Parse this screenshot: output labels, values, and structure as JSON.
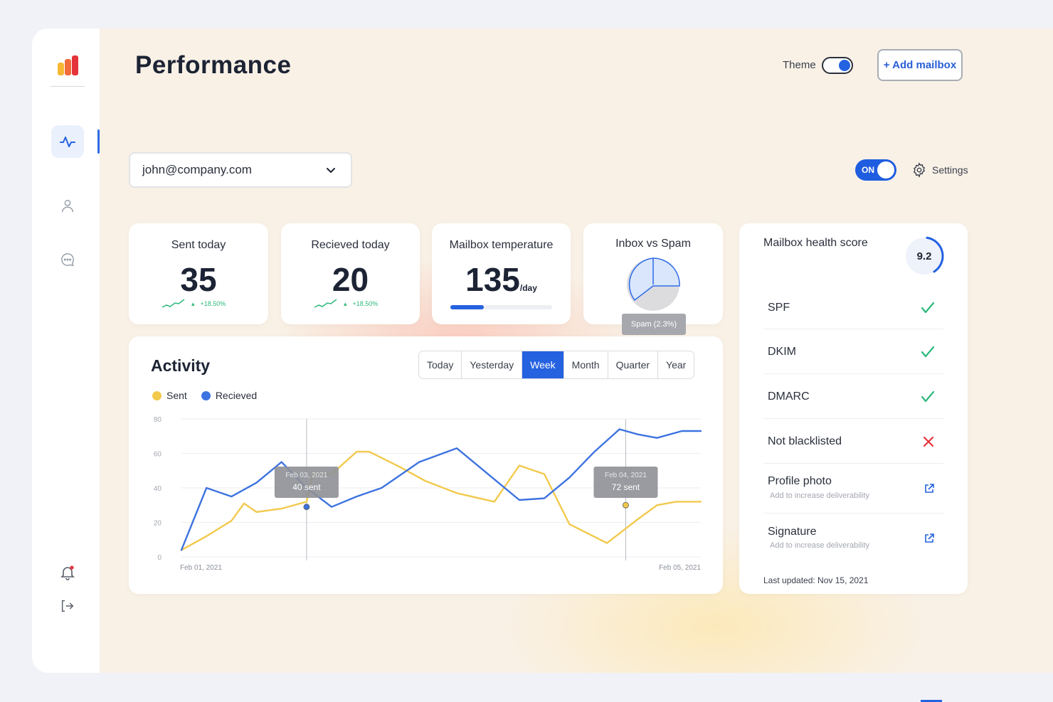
{
  "page": {
    "title": "Performance"
  },
  "header": {
    "theme_label": "Theme",
    "add_mailbox_label": "+ Add mailbox"
  },
  "mailbox": {
    "selected": "john@company.com"
  },
  "toggle": {
    "on_label": "ON"
  },
  "settings": {
    "label": "Settings"
  },
  "stats": [
    {
      "label": "Sent today",
      "value": "35",
      "trend": "+18.50%"
    },
    {
      "label": "Recieved today",
      "value": "20",
      "trend": "+18.50%"
    },
    {
      "label": "Mailbox temperature",
      "value": "135",
      "unit": "/day",
      "progress": 0.33
    }
  ],
  "inbox_spam": {
    "label": "Inbox vs Spam",
    "tooltip": "Spam (2.3%)",
    "spam_percent": 2.3
  },
  "activity": {
    "title": "Activity",
    "tabs": [
      "Today",
      "Yesterday",
      "Week",
      "Month",
      "Quarter",
      "Year"
    ],
    "active_tab": "Week",
    "legend": {
      "sent": "Sent",
      "received": "Recieved"
    }
  },
  "chart_data": {
    "type": "line",
    "x_range": [
      "Feb 01, 2021",
      "Feb 05, 2021"
    ],
    "xlabels": [
      "Feb 01, 2021",
      "Feb 05, 2021"
    ],
    "yticks": [
      "80",
      "60",
      "40",
      "20",
      "0"
    ],
    "ylim": [
      0,
      80
    ],
    "grid": true,
    "legend_position": "top-left",
    "series": [
      {
        "name": "Sent",
        "color": "#f2c94c",
        "x": [
          0,
          0.2,
          0.4,
          0.5,
          0.6,
          0.8,
          1.0,
          1.05,
          1.2,
          1.4,
          1.5,
          1.75,
          1.95,
          2.2,
          2.5,
          2.7,
          2.9,
          3.1,
          3.4,
          3.65,
          3.8,
          3.95,
          4.15
        ],
        "y": [
          4,
          12,
          21,
          31,
          26,
          28,
          32,
          48,
          48,
          61,
          61,
          52,
          44,
          37,
          32,
          53,
          48,
          19,
          8,
          22,
          30,
          32,
          32
        ]
      },
      {
        "name": "Recieved",
        "color": "#3d73e0",
        "x": [
          0,
          0.2,
          0.4,
          0.6,
          0.8,
          1.0,
          1.2,
          1.4,
          1.6,
          1.9,
          2.2,
          2.4,
          2.7,
          2.9,
          3.1,
          3.3,
          3.5,
          3.65,
          3.8,
          4.0,
          4.15
        ],
        "y": [
          4,
          40,
          35,
          43,
          55,
          40,
          29,
          35,
          40,
          55,
          63,
          51,
          33,
          34,
          46,
          61,
          74,
          71,
          69,
          73,
          73
        ]
      }
    ],
    "annotations": [
      {
        "date": "Feb 03, 2021",
        "text": "40 sent",
        "x": 1.0,
        "series": "Recieved",
        "y": 29
      },
      {
        "date": "Feb 04, 2021",
        "text": "72 sent",
        "x": 3.55,
        "series": "Sent",
        "y": 30
      }
    ]
  },
  "health": {
    "title": "Mailbox health score",
    "score": "9.2",
    "score_fraction": 0.92,
    "items": [
      {
        "label": "SPF",
        "status": "check"
      },
      {
        "label": "DKIM",
        "status": "check"
      },
      {
        "label": "DMARC",
        "status": "check"
      },
      {
        "label": "Not blacklisted",
        "status": "cross"
      },
      {
        "label": "Profile photo",
        "sub": "Add to increase deliverability",
        "status": "external-link"
      },
      {
        "label": "Signature",
        "sub": "Add to increase deliverability",
        "status": "external-link"
      }
    ],
    "last_updated": "Last updated: Nov 15, 2021"
  },
  "colors": {
    "accent": "#2462e0",
    "success": "#2bb87a",
    "danger": "#e5333a",
    "sent": "#f2c94c",
    "received": "#3d73e0"
  }
}
